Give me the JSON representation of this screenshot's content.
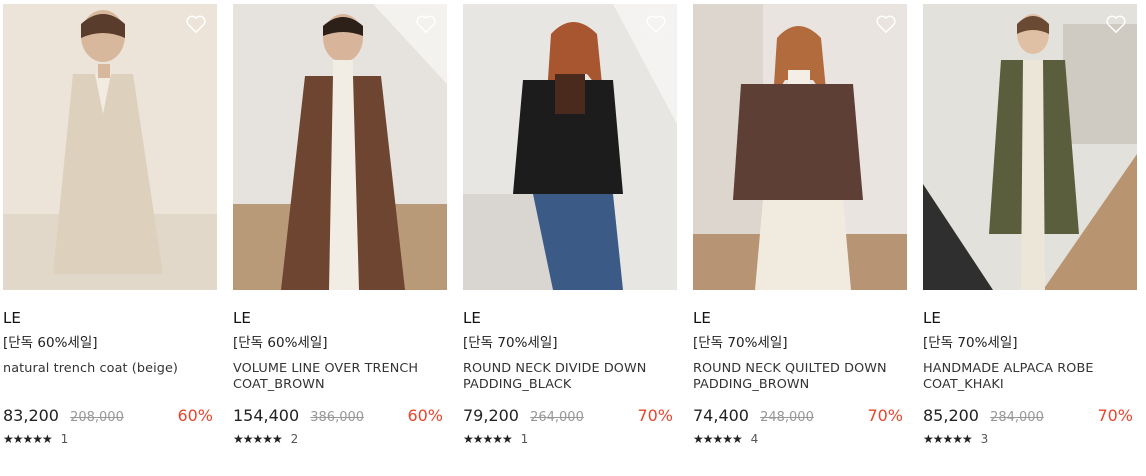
{
  "products": [
    {
      "brand": "LE",
      "promo": "[단독 60%세일]",
      "name": "natural trench coat (beige)",
      "price": "83,200",
      "original_price": "208,000",
      "discount": "60%",
      "stars": "★★★★★",
      "rating": 5,
      "review_count": "1",
      "colors": {
        "bg": "#ece4d8",
        "garment": "#ddd0bd",
        "floor": "#e2d8ca"
      }
    },
    {
      "brand": "LE",
      "promo": "[단독 60%세일]",
      "name": "VOLUME LINE OVER TRENCH COAT_BROWN",
      "price": "154,400",
      "original_price": "386,000",
      "discount": "60%",
      "stars": "★★★★★",
      "rating": 5,
      "review_count": "2",
      "colors": {
        "bg": "#e6e3de",
        "garment": "#6e4531",
        "floor": "#b89a78"
      }
    },
    {
      "brand": "LE",
      "promo": "[단독 70%세일]",
      "name": "ROUND NECK DIVIDE DOWN PADDING_BLACK",
      "price": "79,200",
      "original_price": "264,000",
      "discount": "70%",
      "stars": "★★★★★",
      "rating": 5,
      "review_count": "1",
      "colors": {
        "bg": "#e8e6e3",
        "garment": "#1c1c1c",
        "floor": "#d9d6d2"
      }
    },
    {
      "brand": "LE",
      "promo": "[단독 70%세일]",
      "name": "ROUND NECK QUILTED DOWN PADDING_BROWN",
      "price": "74,400",
      "original_price": "248,000",
      "discount": "70%",
      "stars": "★★★★★",
      "rating": 5,
      "review_count": "4",
      "colors": {
        "bg": "#e9e4df",
        "garment": "#5e3f36",
        "floor": "#b69474"
      }
    },
    {
      "brand": "LE",
      "promo": "[단독 70%세일]",
      "name": "HANDMADE ALPACA ROBE COAT_KHAKI",
      "price": "85,200",
      "original_price": "284,000",
      "discount": "70%",
      "stars": "★★★★★",
      "rating": 5,
      "review_count": "3",
      "colors": {
        "bg": "#e3e1dc",
        "garment": "#5b5e3c",
        "floor": "#b89470"
      }
    }
  ],
  "icons": {
    "wishlist": "heart-outline-icon",
    "rating": "star-icon"
  },
  "accent": {
    "discount": "#e8452c",
    "original_price": "#999999"
  }
}
